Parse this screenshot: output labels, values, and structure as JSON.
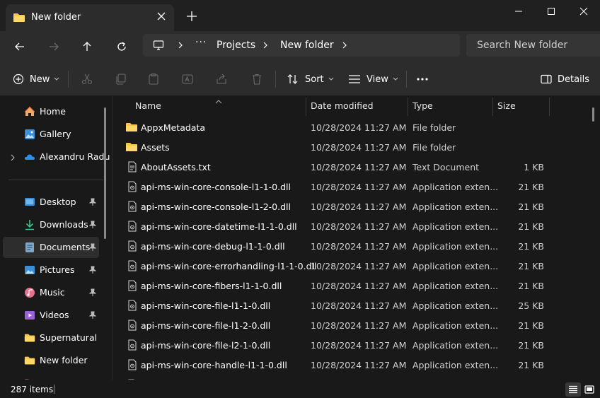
{
  "window": {
    "tab_title": "New folder",
    "colors": {
      "folder": "#f9c74f",
      "accent": "#4cc2ff"
    }
  },
  "address": {
    "segments": [
      "Projects",
      "New folder"
    ],
    "search_placeholder": "Search New folder"
  },
  "toolbar": {
    "new_label": "New",
    "sort_label": "Sort",
    "view_label": "View",
    "details_label": "Details"
  },
  "sidebar": {
    "items": [
      {
        "label": "Home",
        "icon": "home-icon"
      },
      {
        "label": "Gallery",
        "icon": "gallery-icon"
      },
      {
        "label": "Alexandru Radu",
        "icon": "onedrive-icon"
      },
      {
        "label": "Desktop",
        "icon": "desktop-icon"
      },
      {
        "label": "Downloads",
        "icon": "downloads-icon"
      },
      {
        "label": "Documents",
        "icon": "documents-icon"
      },
      {
        "label": "Pictures",
        "icon": "pictures-icon"
      },
      {
        "label": "Music",
        "icon": "music-icon"
      },
      {
        "label": "Videos",
        "icon": "videos-icon"
      },
      {
        "label": "Supernatural",
        "icon": "folder-icon"
      },
      {
        "label": "New folder",
        "icon": "folder-icon"
      }
    ]
  },
  "columns": {
    "name": "Name",
    "date": "Date modified",
    "type": "Type",
    "size": "Size"
  },
  "files": [
    {
      "name": "AppxMetadata",
      "date": "10/28/2024 11:27 AM",
      "type": "File folder",
      "size": "",
      "kind": "folder"
    },
    {
      "name": "Assets",
      "date": "10/28/2024 11:27 AM",
      "type": "File folder",
      "size": "",
      "kind": "folder"
    },
    {
      "name": "AboutAssets.txt",
      "date": "10/28/2024 11:27 AM",
      "type": "Text Document",
      "size": "1 KB",
      "kind": "text"
    },
    {
      "name": "api-ms-win-core-console-l1-1-0.dll",
      "date": "10/28/2024 11:27 AM",
      "type": "Application exten...",
      "size": "21 KB",
      "kind": "dll"
    },
    {
      "name": "api-ms-win-core-console-l1-2-0.dll",
      "date": "10/28/2024 11:27 AM",
      "type": "Application exten...",
      "size": "21 KB",
      "kind": "dll"
    },
    {
      "name": "api-ms-win-core-datetime-l1-1-0.dll",
      "date": "10/28/2024 11:27 AM",
      "type": "Application exten...",
      "size": "21 KB",
      "kind": "dll"
    },
    {
      "name": "api-ms-win-core-debug-l1-1-0.dll",
      "date": "10/28/2024 11:27 AM",
      "type": "Application exten...",
      "size": "21 KB",
      "kind": "dll"
    },
    {
      "name": "api-ms-win-core-errorhandling-l1-1-0.dll",
      "date": "10/28/2024 11:27 AM",
      "type": "Application exten...",
      "size": "21 KB",
      "kind": "dll"
    },
    {
      "name": "api-ms-win-core-fibers-l1-1-0.dll",
      "date": "10/28/2024 11:27 AM",
      "type": "Application exten...",
      "size": "21 KB",
      "kind": "dll"
    },
    {
      "name": "api-ms-win-core-file-l1-1-0.dll",
      "date": "10/28/2024 11:27 AM",
      "type": "Application exten...",
      "size": "25 KB",
      "kind": "dll"
    },
    {
      "name": "api-ms-win-core-file-l1-2-0.dll",
      "date": "10/28/2024 11:27 AM",
      "type": "Application exten...",
      "size": "21 KB",
      "kind": "dll"
    },
    {
      "name": "api-ms-win-core-file-l2-1-0.dll",
      "date": "10/28/2024 11:27 AM",
      "type": "Application exten...",
      "size": "21 KB",
      "kind": "dll"
    },
    {
      "name": "api-ms-win-core-handle-l1-1-0.dll",
      "date": "10/28/2024 11:27 AM",
      "type": "Application exten...",
      "size": "21 KB",
      "kind": "dll"
    }
  ],
  "status": {
    "item_count": "287 items"
  }
}
